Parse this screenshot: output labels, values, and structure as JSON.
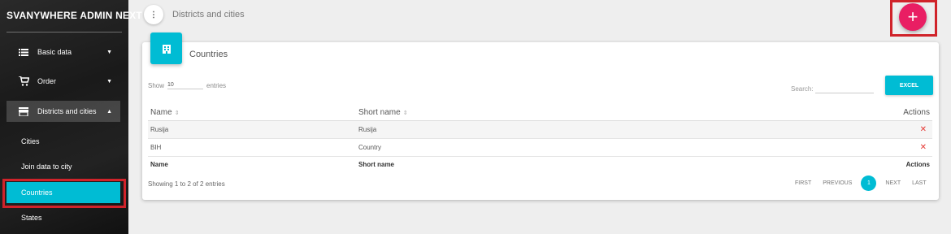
{
  "sidebar": {
    "brand": "SVANYWHERE ADMIN NEXT",
    "items": [
      {
        "label": "Basic data",
        "icon": "list-icon"
      },
      {
        "label": "Order",
        "icon": "cart-icon"
      },
      {
        "label": "Districts and cities",
        "icon": "store-icon"
      }
    ],
    "sub_items": [
      {
        "label": "Cities"
      },
      {
        "label": "Join data to city"
      },
      {
        "label": "Countries",
        "active": true
      },
      {
        "label": "States"
      }
    ]
  },
  "header": {
    "menu_icon": "more-vert-icon",
    "title": "Districts and cities",
    "add_icon": "plus-icon",
    "add_label": "+"
  },
  "card": {
    "icon": "building-icon",
    "title": "Countries",
    "show_label": "Show",
    "length_value": "10",
    "entries_label": "entries",
    "search_label": "Search:",
    "excel_label": "EXCEL",
    "table": {
      "columns": [
        "Name",
        "Short name",
        "Actions"
      ],
      "rows": [
        {
          "name": "Rusija",
          "short_name": "Rusija",
          "action": "✕"
        },
        {
          "name": "BIH",
          "short_name": "Country",
          "action": "✕"
        }
      ],
      "footer": [
        "Name",
        "Short name",
        "Actions"
      ]
    },
    "info": "Showing 1 to 2 of 2 entries",
    "pager": {
      "first": "FIRST",
      "previous": "PREVIOUS",
      "current": "1",
      "next": "NEXT",
      "last": "LAST"
    }
  },
  "colors": {
    "accent": "#00bcd4",
    "fab": "#e91e63",
    "highlight": "#d0232a",
    "delete": "#e53935"
  }
}
